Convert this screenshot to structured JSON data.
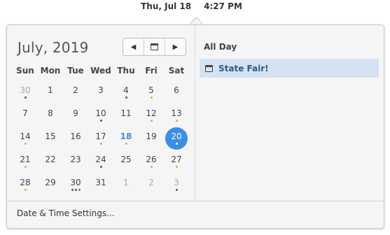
{
  "topbar": {
    "date": "Thu, Jul 18",
    "time": "4:27 PM"
  },
  "calendar": {
    "month_title": "July, 2019",
    "nav": {
      "prev_icon": "chevron-left-icon",
      "today_icon": "calendar-icon",
      "next_icon": "chevron-right-icon"
    },
    "weekdays": [
      "Sun",
      "Mon",
      "Tue",
      "Wed",
      "Thu",
      "Fri",
      "Sat"
    ],
    "weeks": [
      [
        {
          "d": "30",
          "other": true,
          "dots": [
            "gray"
          ]
        },
        {
          "d": "1"
        },
        {
          "d": "2"
        },
        {
          "d": "3"
        },
        {
          "d": "4",
          "dots": [
            "gray"
          ]
        },
        {
          "d": "5",
          "dots": [
            "orange"
          ]
        },
        {
          "d": "6"
        }
      ],
      [
        {
          "d": "7"
        },
        {
          "d": "8"
        },
        {
          "d": "9"
        },
        {
          "d": "10",
          "dots": [
            "gray"
          ]
        },
        {
          "d": "11"
        },
        {
          "d": "12",
          "dots": [
            "orange"
          ]
        },
        {
          "d": "13",
          "dots": [
            "orange"
          ]
        }
      ],
      [
        {
          "d": "14",
          "dots": [
            "orange"
          ]
        },
        {
          "d": "15"
        },
        {
          "d": "16"
        },
        {
          "d": "17",
          "dots": [
            "orange"
          ]
        },
        {
          "d": "18",
          "today": true,
          "dots": [
            "orange"
          ]
        },
        {
          "d": "19"
        },
        {
          "d": "20",
          "selected": true,
          "dots": [
            "white"
          ]
        }
      ],
      [
        {
          "d": "21",
          "dots": [
            "orange"
          ]
        },
        {
          "d": "22"
        },
        {
          "d": "23"
        },
        {
          "d": "24",
          "dots": [
            "gray"
          ]
        },
        {
          "d": "25"
        },
        {
          "d": "26",
          "dots": [
            "orange"
          ]
        },
        {
          "d": "27",
          "dots": [
            "orange"
          ]
        }
      ],
      [
        {
          "d": "28",
          "dots": [
            "orange"
          ]
        },
        {
          "d": "29"
        },
        {
          "d": "30",
          "dots": [
            "gray",
            "gray",
            "blue"
          ]
        },
        {
          "d": "31"
        },
        {
          "d": "1",
          "other": true
        },
        {
          "d": "2",
          "other": true
        },
        {
          "d": "3",
          "other": true,
          "dots": [
            "gray"
          ]
        }
      ]
    ]
  },
  "events": {
    "all_day_label": "All Day",
    "items": [
      {
        "label": "State Fair!",
        "icon": "calendar-icon"
      }
    ]
  },
  "footer": {
    "settings_label": "Date & Time Settings..."
  }
}
